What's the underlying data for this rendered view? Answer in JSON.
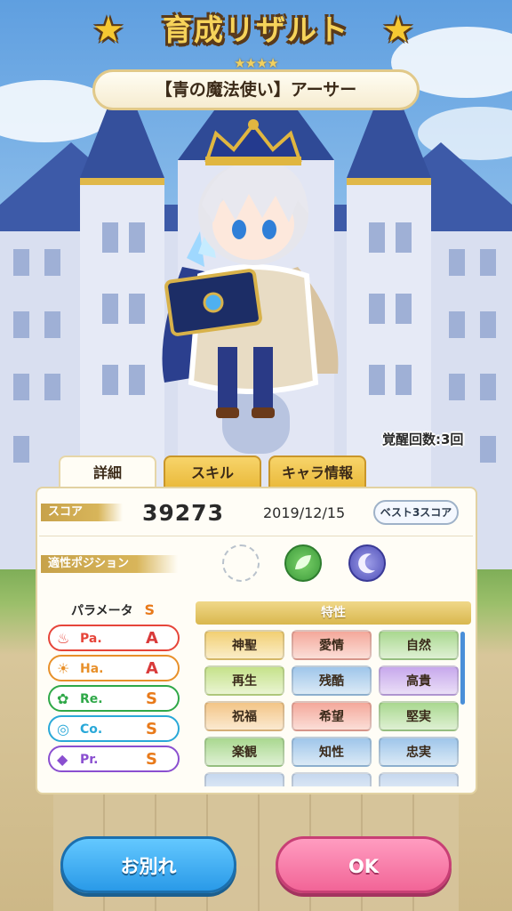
{
  "header": {
    "title": "育成リザルト",
    "rarity_stars": "★★★★",
    "character_name": "【青の魔法使い】アーサー"
  },
  "awakening_label": "覚醒回数:3回",
  "tabs": [
    {
      "label": "詳細",
      "active": true
    },
    {
      "label": "スキル",
      "active": false
    },
    {
      "label": "キャラ情報",
      "active": false
    }
  ],
  "score": {
    "label": "スコア",
    "value": "39273",
    "date": "2019/12/15",
    "best_button": "ベスト3スコア"
  },
  "position": {
    "label": "適性ポジション",
    "icons": [
      "empty-slot",
      "leaf-icon",
      "moon-icon"
    ]
  },
  "parameters": {
    "title": "パラメータ",
    "overall_rank": "S",
    "items": [
      {
        "name": "Pa.",
        "rank": "A",
        "icon": "flame-icon",
        "color": "#e6453a",
        "rank_color": "#d93a3a"
      },
      {
        "name": "Ha.",
        "rank": "A",
        "icon": "sun-icon",
        "color": "#e8902a",
        "rank_color": "#d93a3a"
      },
      {
        "name": "Re.",
        "rank": "S",
        "icon": "clover-icon",
        "color": "#2fa848",
        "rank_color": "#e87a1a"
      },
      {
        "name": "Co.",
        "rank": "S",
        "icon": "orbit-icon",
        "color": "#29a8d8",
        "rank_color": "#e87a1a"
      },
      {
        "name": "Pr.",
        "rank": "S",
        "icon": "diamond-icon",
        "color": "#8a4fd0",
        "rank_color": "#e87a1a"
      }
    ]
  },
  "traits": {
    "title": "特性",
    "items": [
      {
        "label": "神聖",
        "color": "#f2cf72"
      },
      {
        "label": "愛情",
        "color": "#f4a89a"
      },
      {
        "label": "自然",
        "color": "#a9d88f"
      },
      {
        "label": "再生",
        "color": "#c5e28a"
      },
      {
        "label": "残酷",
        "color": "#9fc6ea"
      },
      {
        "label": "高貴",
        "color": "#c7a8ec"
      },
      {
        "label": "祝福",
        "color": "#f3c586"
      },
      {
        "label": "希望",
        "color": "#f4a89a"
      },
      {
        "label": "堅実",
        "color": "#a9d88f"
      },
      {
        "label": "楽観",
        "color": "#a9d88f"
      },
      {
        "label": "知性",
        "color": "#9fc6ea"
      },
      {
        "label": "忠実",
        "color": "#9fc6ea"
      }
    ]
  },
  "buttons": {
    "farewell": "お別れ",
    "ok": "OK"
  }
}
